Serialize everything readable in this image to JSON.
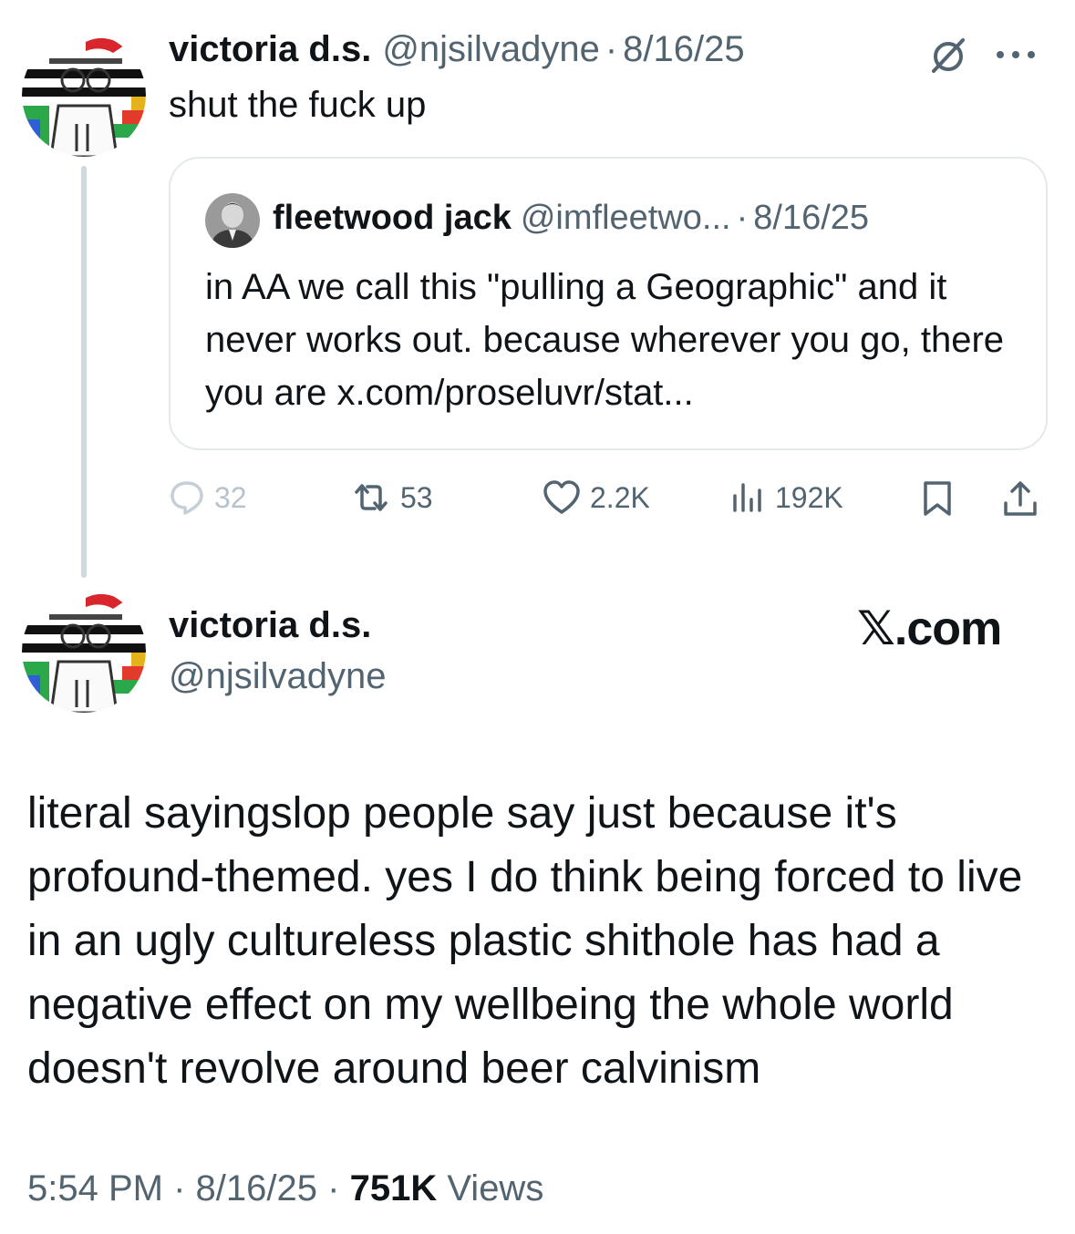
{
  "reply": {
    "author_name": "victoria d.s.",
    "author_handle": "@njsilvadyne",
    "separator": "·",
    "date": "8/16/25",
    "text": "shut the fuck up"
  },
  "quote": {
    "author_name": "fleetwood jack",
    "author_handle": "@imfleetwo...",
    "separator": "·",
    "date": "8/16/25",
    "text": "in AA we call this \"pulling a Geographic\" and it never works out. because wherever you go, there you are x.com/proseluvr/stat..."
  },
  "actions": {
    "replies": "32",
    "reposts": "53",
    "likes": "2.2K",
    "views": "192K"
  },
  "main": {
    "author_name": "victoria d.s.",
    "author_handle": "@njsilvadyne",
    "brand": "𝕏.com",
    "text": "literal sayingslop people say just because it's profound-themed. yes I do think being forced to live in an ugly cultureless plastic shithole has had a negative effect on my wellbeing the whole world doesn't revolve around beer calvinism",
    "time": "5:54 PM",
    "separator": "·",
    "date": "8/16/25",
    "views_count": "751K",
    "views_label": "Views"
  },
  "icons": [
    "grok-slash-icon",
    "more-icon",
    "reply-icon",
    "repost-icon",
    "like-icon",
    "views-icon",
    "bookmark-icon",
    "share-icon"
  ],
  "colors": {
    "text": "#0f1419",
    "muted": "#536471",
    "border": "#e4e9ec",
    "thread": "#cfd9de"
  }
}
